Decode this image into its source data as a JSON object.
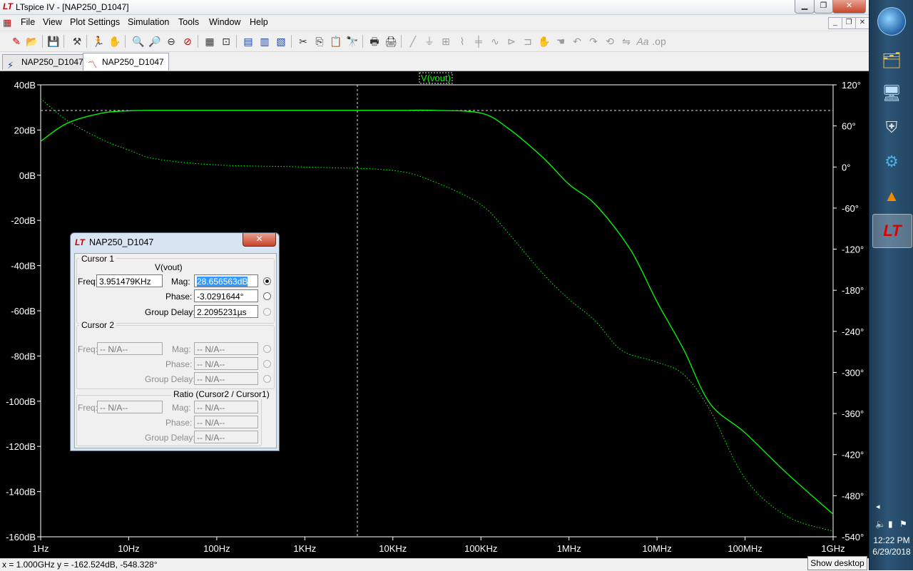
{
  "window": {
    "title": "LTspice IV - [NAP250_D1047]",
    "minimize": "▁",
    "restore": "❐",
    "close": "✕"
  },
  "menu": [
    "File",
    "View",
    "Plot Settings",
    "Simulation",
    "Tools",
    "Window",
    "Help"
  ],
  "mdi_buttons": [
    "_",
    "❐",
    "✕"
  ],
  "tabs": [
    {
      "label": "NAP250_D1047",
      "icon": "schematic-icon"
    },
    {
      "label": "NAP250_D1047",
      "icon": "waveform-icon"
    }
  ],
  "plot": {
    "trace_label": "V(vout)",
    "trace_color": "#00ff00",
    "left_ticks": [
      "40dB",
      "20dB",
      "0dB",
      "-20dB",
      "-40dB",
      "-60dB",
      "-80dB",
      "-100dB",
      "-120dB",
      "-140dB",
      "-160dB"
    ],
    "right_ticks": [
      "120°",
      "60°",
      "0°",
      "-60°",
      "-120°",
      "-180°",
      "-240°",
      "-300°",
      "-360°",
      "-420°",
      "-480°",
      "-540°"
    ],
    "x_ticks": [
      "1Hz",
      "10Hz",
      "100Hz",
      "1KHz",
      "10KHz",
      "100KHz",
      "1MHz",
      "10MHz",
      "100MHz",
      "1GHz"
    ]
  },
  "chart_data": {
    "type": "line",
    "title": "V(vout)",
    "x_scale": "log",
    "xlim": [
      1,
      1000000000
    ],
    "ylim_left": [
      -160,
      40
    ],
    "ylim_right": [
      -540,
      120
    ],
    "grid": false,
    "cursor": {
      "freq_hz": 3951.479,
      "mag_db": 28.656563
    },
    "series": [
      {
        "name": "V(vout)",
        "axis": "left",
        "style": "solid",
        "x": [
          1,
          2,
          5,
          10,
          20,
          100,
          1000,
          10000,
          30000,
          100000,
          200000,
          500000,
          1000000,
          2000000,
          5000000,
          10000000,
          20000000,
          40000000,
          100000000,
          300000000,
          1000000000
        ],
        "y": [
          15,
          23,
          27.5,
          28.5,
          28.7,
          28.7,
          28.7,
          28.7,
          28.7,
          27.5,
          21,
          8,
          -4,
          -13,
          -33,
          -56,
          -77,
          -101,
          -114,
          -132,
          -150
        ]
      },
      {
        "name": "phase",
        "axis": "right",
        "style": "dotted",
        "x": [
          1,
          2,
          5,
          10,
          20,
          100,
          1000,
          10000,
          30000,
          100000,
          200000,
          500000,
          1000000,
          2000000,
          4000000,
          10000000,
          20000000,
          40000000,
          100000000,
          300000000,
          1000000000
        ],
        "y": [
          100,
          68,
          40,
          25,
          12,
          3,
          0,
          -5,
          -22,
          -55,
          -95,
          -155,
          -193,
          -225,
          -268,
          -285,
          -303,
          -355,
          -455,
          -510,
          -532
        ]
      }
    ]
  },
  "dialog": {
    "title": "NAP250_D1047",
    "close": "✕",
    "cursor1": {
      "group": "Cursor 1",
      "trace": "V(vout)",
      "freq_label": "Freq:",
      "freq": "3.951479KHz",
      "mag_label": "Mag:",
      "mag": "28.656563dB",
      "phase_label": "Phase:",
      "phase": "-3.0291644°",
      "gd_label": "Group Delay:",
      "gd": "2.2095231µs"
    },
    "cursor2": {
      "group": "Cursor 2",
      "freq_label": "Freq:",
      "freq": "-- N/A--",
      "mag_label": "Mag:",
      "mag": "-- N/A--",
      "phase_label": "Phase:",
      "phase": "-- N/A--",
      "gd_label": "Group Delay:",
      "gd": "-- N/A--"
    },
    "ratio": {
      "group": "Ratio (Cursor2 / Cursor1)",
      "freq_label": "Freq:",
      "freq": "-- N/A--",
      "mag_label": "Mag:",
      "mag": "-- N/A--",
      "phase_label": "Phase:",
      "phase": "-- N/A--",
      "gd_label": "Group Delay:",
      "gd": "-- N/A--"
    }
  },
  "status": {
    "text": "x = 1.000GHz   y = -162.524dB, -548.328°"
  },
  "taskbar": {
    "time": "12:22 PM",
    "date": "6/29/2018",
    "show_desktop": "Show desktop",
    "tray_arrow": "◂",
    "tray_icons": [
      "speaker-icon",
      "network-icon",
      "flag-icon"
    ],
    "apps": [
      "start-orb-icon",
      "file-explorer-icon",
      "remote-desktop-icon",
      "wd-security-icon",
      "support-assist-icon",
      "vlc-icon",
      "ltspice-icon"
    ]
  }
}
